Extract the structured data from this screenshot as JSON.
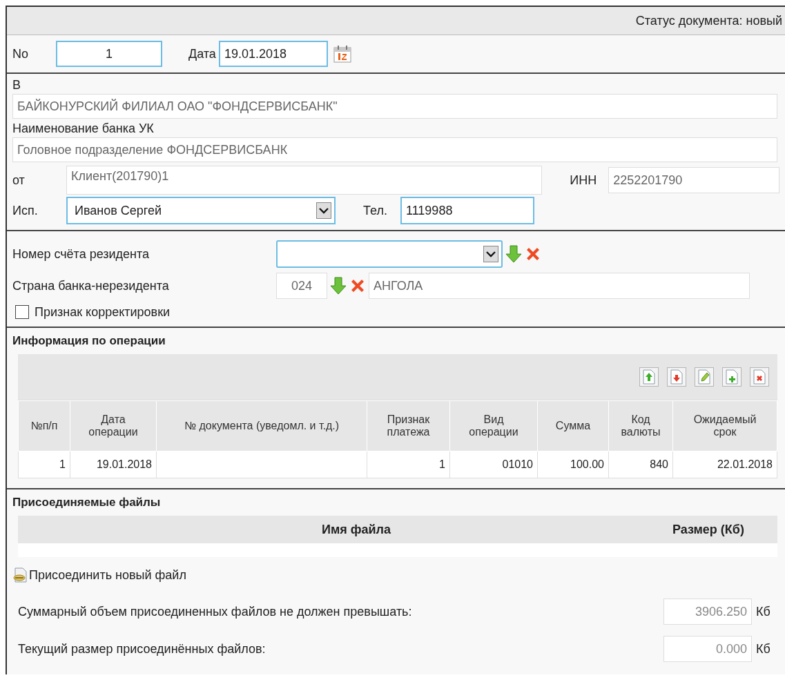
{
  "status_bar": {
    "text": "Статус документа: новый"
  },
  "header": {
    "number_label": "No",
    "number": "1",
    "date_label": "Дата",
    "date": "19.01.2018"
  },
  "bank": {
    "to_label": "В",
    "to_bank": "БАЙКОНУРСКИЙ ФИЛИАЛ ОАО \"ФОНДСЕРВИСБАНК\"",
    "uk_label": "Наименование банка УК",
    "uk_bank": "Головное подразделение ФОНДСЕРВИСБАНК",
    "from_label": "от",
    "from": "Клиент(201790)1",
    "inn_label": "ИНН",
    "inn": "2252201790",
    "executor_label": "Исп.",
    "executor": "Иванов Сергей",
    "phone_label": "Тел.",
    "phone": "1119988"
  },
  "resident": {
    "account_label": "Номер счёта резидента",
    "country_label": "Страна банка-нерезидента",
    "country_code": "024",
    "country_name": "АНГОЛА",
    "correction": {
      "label": "Признак корректировки",
      "checked": false
    }
  },
  "operations": {
    "title": "Информация по операции",
    "toolbar": [
      {
        "kind": "up"
      },
      {
        "kind": "down"
      },
      {
        "kind": "edit"
      },
      {
        "kind": "add"
      },
      {
        "kind": "delete"
      }
    ],
    "columns": [
      "№п/п",
      "Дата\nоперации",
      "№ документа (уведомл. и т.д.)",
      "Признак\nплатежа",
      "Вид\nоперации",
      "Сумма",
      "Код\nвалюты",
      "Ожидаемый\nсрок"
    ],
    "rows": [
      [
        "1",
        "19.01.2018",
        "",
        "1",
        "01010",
        "100.00",
        "840",
        "22.01.2018"
      ]
    ]
  },
  "files": {
    "title": "Присоединяемые файлы",
    "columns": [
      "Имя файла",
      "Размер (Кб)"
    ],
    "attach_link": "Присоединить новый файл",
    "limits": [
      {
        "label": "Суммарный объем присоединенных файлов не должен превышать:",
        "value": "3906.250",
        "unit": "Кб"
      },
      {
        "label": "Текущий размер присоединённых файлов:",
        "value": "0.000",
        "unit": "Кб"
      }
    ]
  }
}
